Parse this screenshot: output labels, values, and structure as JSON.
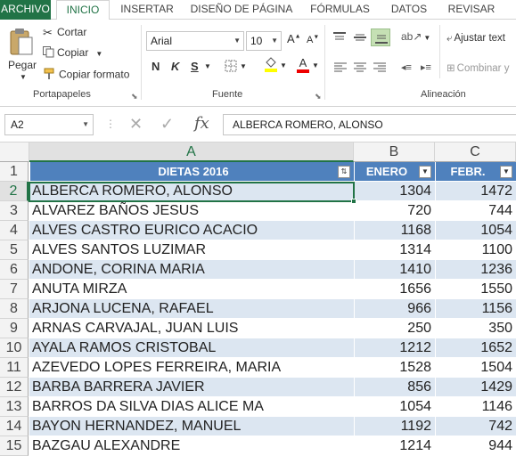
{
  "tabs": [
    "ARCHIVO",
    "INICIO",
    "INSERTAR",
    "DISEÑO DE PÁGINA",
    "FÓRMULAS",
    "DATOS",
    "REVISAR"
  ],
  "ribbon": {
    "paste_label": "Pegar",
    "cut_label": "Cortar",
    "copy_label": "Copiar",
    "copy_format_label": "Copiar formato",
    "clipboard_group": "Portapapeles",
    "font_name": "Arial",
    "font_size": "10",
    "bold": "N",
    "italic": "K",
    "underline": "S",
    "font_group": "Fuente",
    "wrap_text": "Ajustar text",
    "merge": "Combinar y",
    "align_group": "Alineación"
  },
  "formula_bar": {
    "name_box": "A2",
    "fx": "fx",
    "content": "ALBERCA ROMERO, ALONSO"
  },
  "grid": {
    "columns": [
      "A",
      "B",
      "C"
    ],
    "header": {
      "a": "DIETAS 2016",
      "b": "ENERO",
      "c": "FEBR."
    },
    "rows": [
      {
        "num": "2",
        "name": "ALBERCA ROMERO, ALONSO",
        "b": "1304",
        "c": "1472"
      },
      {
        "num": "3",
        "name": "ALVAREZ BAÑOS JESUS",
        "b": "720",
        "c": "744"
      },
      {
        "num": "4",
        "name": "ALVES CASTRO EURICO ACACIO",
        "b": "1168",
        "c": "1054"
      },
      {
        "num": "5",
        "name": "ALVES SANTOS LUZIMAR",
        "b": "1314",
        "c": "1100"
      },
      {
        "num": "6",
        "name": "ANDONE, CORINA MARIA",
        "b": "1410",
        "c": "1236"
      },
      {
        "num": "7",
        "name": "ANUTA MIRZA",
        "b": "1656",
        "c": "1550"
      },
      {
        "num": "8",
        "name": "ARJONA LUCENA, RAFAEL",
        "b": "966",
        "c": "1156"
      },
      {
        "num": "9",
        "name": "ARNAS CARVAJAL, JUAN LUIS",
        "b": "250",
        "c": "350"
      },
      {
        "num": "10",
        "name": "AYALA RAMOS CRISTOBAL",
        "b": "1212",
        "c": "1652"
      },
      {
        "num": "11",
        "name": "AZEVEDO LOPES FERREIRA, MARIA",
        "b": "1528",
        "c": "1504"
      },
      {
        "num": "12",
        "name": "BARBA BARRERA JAVIER",
        "b": "856",
        "c": "1429"
      },
      {
        "num": "13",
        "name": "BARROS DA SILVA DIAS ALICE MA",
        "b": "1054",
        "c": "1146"
      },
      {
        "num": "14",
        "name": "BAYON HERNANDEZ, MANUEL",
        "b": "1192",
        "c": "742"
      },
      {
        "num": "15",
        "name": "BAZGAU ALEXANDRE",
        "b": "1214",
        "c": "944"
      }
    ]
  },
  "colors": {
    "accent": "#217346",
    "table_header": "#4f81bd",
    "band": "#dce6f1"
  }
}
